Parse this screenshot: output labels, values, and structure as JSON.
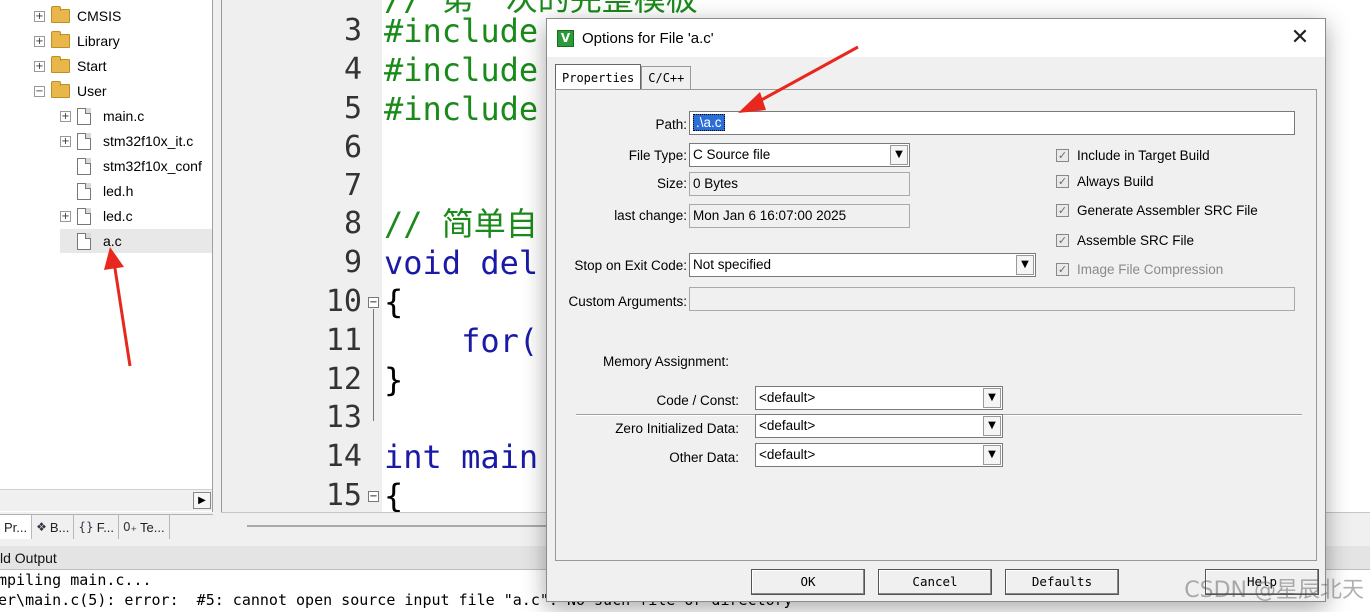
{
  "tree": {
    "items": [
      {
        "label": "CMSIS",
        "kind": "folder",
        "expander": "+"
      },
      {
        "label": "Library",
        "kind": "folder",
        "expander": "+"
      },
      {
        "label": "Start",
        "kind": "folder",
        "expander": "+"
      },
      {
        "label": "User",
        "kind": "folder",
        "expander": "−"
      },
      {
        "label": "main.c",
        "kind": "file",
        "expander": "+"
      },
      {
        "label": "stm32f10x_it.c",
        "kind": "file",
        "expander": "+"
      },
      {
        "label": "stm32f10x_conf",
        "kind": "file",
        "expander": ""
      },
      {
        "label": "led.h",
        "kind": "file",
        "expander": ""
      },
      {
        "label": "led.c",
        "kind": "file",
        "expander": "+"
      },
      {
        "label": "a.c",
        "kind": "file",
        "expander": ""
      }
    ]
  },
  "panel_tabs": [
    {
      "label": "Pr...",
      "icon": "project-icon"
    },
    {
      "label": "B...",
      "icon": "books-icon"
    },
    {
      "label": "F...",
      "icon": "functions-icon"
    },
    {
      "label": "Te...",
      "icon": "templates-icon"
    }
  ],
  "editor": {
    "lines": [
      {
        "num": "3",
        "code": "#include"
      },
      {
        "num": "4",
        "code": "#include"
      },
      {
        "num": "5",
        "code": "#include"
      },
      {
        "num": "6",
        "code": ""
      },
      {
        "num": "7",
        "code": ""
      },
      {
        "num": "8",
        "code": "// 简单自"
      },
      {
        "num": "9",
        "code": "void del"
      },
      {
        "num": "10",
        "code": "{"
      },
      {
        "num": "11",
        "code": "    for("
      },
      {
        "num": "12",
        "code": "}"
      },
      {
        "num": "13",
        "code": ""
      },
      {
        "num": "14",
        "code": "int main"
      },
      {
        "num": "15",
        "code": "{"
      }
    ],
    "top_partial": "// 第一次的完整模板"
  },
  "output": {
    "title": "ld Output",
    "lines": [
      "mpiling main.c...",
      "er\\main.c(5): error:  #5: cannot open source input file \"a.c\": No such file or directory"
    ]
  },
  "dialog": {
    "title": "Options for File 'a.c'",
    "close": "✕",
    "tabs": [
      "Properties",
      "C/C++"
    ],
    "path_label": "Path:",
    "path_value": ".\\a.c",
    "file_type_label": "File Type:",
    "file_type_value": "C Source file",
    "size_label": "Size:",
    "size_value": "0 Bytes",
    "last_change_label": "last change:",
    "last_change_value": "Mon Jan  6 16:07:00 2025",
    "stop_label": "Stop on Exit Code:",
    "stop_value": "Not specified",
    "custom_args_label": "Custom Arguments:",
    "custom_args_value": "",
    "checks": [
      {
        "label": "Include in Target Build",
        "checked": true,
        "disabled": false
      },
      {
        "label": "Always Build",
        "checked": true,
        "disabled": false
      },
      {
        "label": "Generate Assembler SRC File",
        "checked": true,
        "disabled": false
      },
      {
        "label": "Assemble SRC File",
        "checked": true,
        "disabled": false
      },
      {
        "label": "Image File Compression",
        "checked": true,
        "disabled": true
      }
    ],
    "memory_title": "Memory Assignment:",
    "memory": [
      {
        "label": "Code / Const:",
        "value": "<default>"
      },
      {
        "label": "Zero Initialized Data:",
        "value": "<default>"
      },
      {
        "label": "Other Data:",
        "value": "<default>"
      }
    ],
    "buttons": {
      "ok": "OK",
      "cancel": "Cancel",
      "defaults": "Defaults",
      "help": "Help"
    }
  },
  "watermark": "CSDN @星辰北天",
  "colors": {
    "annotation_arrow": "#e8281e",
    "selection": "#2c6ed8",
    "keyword": "#1a1aa6",
    "comment": "#1a8a1a"
  }
}
